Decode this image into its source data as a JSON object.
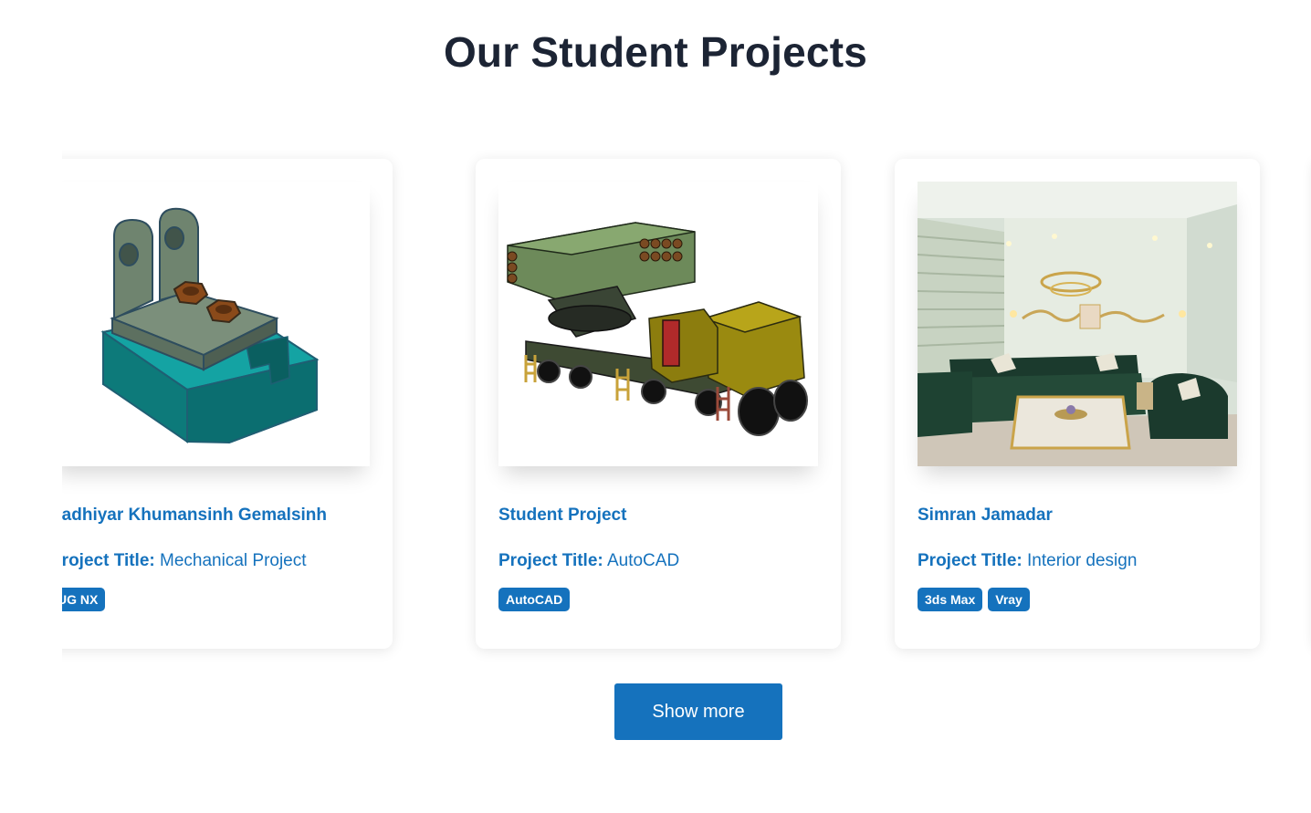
{
  "section": {
    "title": "Our Student Projects"
  },
  "project_label": "Project Title:",
  "projects": [
    {
      "student": "Padhiyar Khumansinh Gemalsinh",
      "project_title": "Mechanical Project",
      "tags": [
        "UG NX"
      ],
      "image": "mechanical-part-render"
    },
    {
      "student": "Student Project",
      "project_title": "AutoCAD",
      "tags": [
        "AutoCAD"
      ],
      "image": "rocket-launcher-truck-render"
    },
    {
      "student": "Simran Jamadar",
      "project_title": "Interior design",
      "tags": [
        "3ds Max",
        "Vray"
      ],
      "image": "living-room-interior-render"
    }
  ],
  "actions": {
    "show_more": "Show more"
  },
  "colors": {
    "accent": "#1572bd",
    "heading": "#1c2434"
  }
}
